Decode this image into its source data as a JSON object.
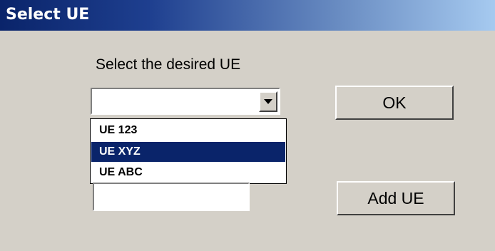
{
  "window": {
    "title": "Select UE"
  },
  "prompt": {
    "label": "Select the desired UE"
  },
  "ue_combo": {
    "value": "",
    "options": [
      "UE 123",
      "UE XYZ",
      "UE ABC"
    ],
    "highlighted": "UE XYZ",
    "arrow_icon": "chevron-down-icon"
  },
  "buttons": {
    "ok": "OK",
    "add_ue": "Add UE"
  },
  "new_ue_field": {
    "value": ""
  },
  "colors": {
    "dialog_background": "#d4d0c8",
    "titlebar_start": "#0a246a",
    "titlebar_end": "#a6caf0",
    "selection_background": "#0a246a"
  }
}
